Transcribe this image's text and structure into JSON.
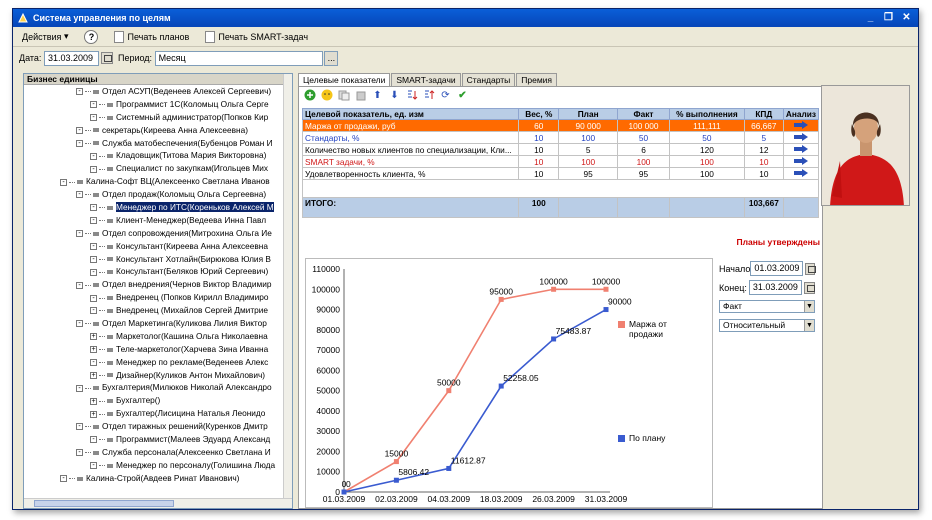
{
  "window": {
    "title": "Система управления по целям"
  },
  "menu": {
    "actions": "Действия",
    "help": "?",
    "print_plans": "Печать планов",
    "print_smart": "Печать SMART-задач"
  },
  "filter": {
    "date_label": "Дата:",
    "date_value": "31.03.2009",
    "period_label": "Период:",
    "period_value": "Месяц",
    "period_btn": "..."
  },
  "tree": {
    "header": "Бизнес единицы",
    "rows": [
      {
        "lvl": 2,
        "exp": "-",
        "text": "Отдел АСУП(Веденеев Алексей Сергеевич)"
      },
      {
        "lvl": 3,
        "exp": "-",
        "text": "Программист 1С(Коломыц Ольга Серге"
      },
      {
        "lvl": 3,
        "exp": "-",
        "text": "Системный администратор(Попков Кир"
      },
      {
        "lvl": 2,
        "exp": "-",
        "text": "секретарь(Киреева Анна Алексеевна)"
      },
      {
        "lvl": 2,
        "exp": "-",
        "text": "Служба матобеспечения(Бубенцов Роман И"
      },
      {
        "lvl": 3,
        "exp": "-",
        "text": "Кладовщик(Титова Мария Викторовна)"
      },
      {
        "lvl": 3,
        "exp": "-",
        "text": "Специалист по закупкам(Игольцев Мих"
      },
      {
        "lvl": 1,
        "exp": "-",
        "text": "Калина-Софт ВЦ(Алексеенко Светлана Иванов"
      },
      {
        "lvl": 2,
        "exp": "-",
        "text": "Отдел продаж(Коломыц Ольга Сергеевна)"
      },
      {
        "lvl": 3,
        "exp": "-",
        "text": "Менеджер по ИТС(Кореньков Алексей М",
        "sel": true
      },
      {
        "lvl": 3,
        "exp": "-",
        "text": "Клиент-Менеджер(Ведеева Инна Павл"
      },
      {
        "lvl": 2,
        "exp": "-",
        "text": "Отдел сопровождения(Митрохина Ольга Ие"
      },
      {
        "lvl": 3,
        "exp": "-",
        "text": "Консультант(Киреева Анна Алексеевна"
      },
      {
        "lvl": 3,
        "exp": "-",
        "text": "Консультант Хотлайн(Бирюкова Юлия В"
      },
      {
        "lvl": 3,
        "exp": "-",
        "text": "Консультант(Беляков Юрий Сергеевич)"
      },
      {
        "lvl": 2,
        "exp": "-",
        "text": "Отдел внедрения(Чернов Виктор Владимир"
      },
      {
        "lvl": 3,
        "exp": "-",
        "text": "Внедренец (Попков Кирилл Владимиро"
      },
      {
        "lvl": 3,
        "exp": "-",
        "text": "Внедренец (Михайлов Сергей Дмитрие"
      },
      {
        "lvl": 2,
        "exp": "-",
        "text": "Отдел Маркетинга(Куликова Лилия Виктор"
      },
      {
        "lvl": 3,
        "exp": "+",
        "text": "Маркетолог(Кашина Ольга Николаевна"
      },
      {
        "lvl": 3,
        "exp": "+",
        "text": "Теле-маркетолог(Харчева Зина Иванна"
      },
      {
        "lvl": 3,
        "exp": "-",
        "text": "Менеджер по рекламе(Веденеев Алекс"
      },
      {
        "lvl": 3,
        "exp": "+",
        "text": "Дизайнер(Куликов Антон Михайлович)"
      },
      {
        "lvl": 2,
        "exp": "-",
        "text": "Бухгалтерия(Милюков Николай Александро"
      },
      {
        "lvl": 3,
        "exp": "+",
        "text": "Бухгалтер()"
      },
      {
        "lvl": 3,
        "exp": "+",
        "text": "Бухгалтер(Лисицина Наталья Леонидо"
      },
      {
        "lvl": 2,
        "exp": "-",
        "text": "Отдел тиражных решений(Куренков Дмитр"
      },
      {
        "lvl": 3,
        "exp": "-",
        "text": "Программист(Малеев Эдуард Александ"
      },
      {
        "lvl": 2,
        "exp": "-",
        "text": "Служба персонала(Алексеенко Светлана И"
      },
      {
        "lvl": 3,
        "exp": "-",
        "text": "Менеджер по персоналу(Голишина Люда"
      },
      {
        "lvl": 1,
        "exp": "-",
        "text": "Калина-Строй(Авдеев Ринат Иванович)"
      }
    ]
  },
  "tabs": [
    "Целевые показатели",
    "SMART-задачи",
    "Стандарты",
    "Премия"
  ],
  "table": {
    "headers": [
      "Целевой показатель, ед. изм",
      "Вес, %",
      "План",
      "Факт",
      "% выполнения",
      "КПД",
      "Анализ"
    ],
    "rows": [
      {
        "name": "Маржа от продажи, руб",
        "weight": "60",
        "plan": "90 000",
        "fact": "100 000",
        "pct": "111,111",
        "kpd": "66,667",
        "style": "orange"
      },
      {
        "name": "Стандарты, %",
        "weight": "10",
        "plan": "100",
        "fact": "50",
        "pct": "50",
        "kpd": "5",
        "style": "blue"
      },
      {
        "name": "Количество новых клиентов по специализации, Кли...",
        "weight": "10",
        "plan": "5",
        "fact": "6",
        "pct": "120",
        "kpd": "12",
        "style": "normal"
      },
      {
        "name": "SMART задачи, %",
        "weight": "10",
        "plan": "100",
        "fact": "100",
        "pct": "100",
        "kpd": "10",
        "style": "red"
      },
      {
        "name": "Удовлетворенность клиента, %",
        "weight": "10",
        "plan": "95",
        "fact": "95",
        "pct": "100",
        "kpd": "10",
        "style": "normal"
      }
    ],
    "total": {
      "label": "ИТОГО:",
      "weight": "100",
      "kpd": "103,667"
    }
  },
  "status": "Планы утверждены",
  "side": {
    "start_label": "Начало",
    "start_value": "01.03.2009",
    "end_label": "Конец:",
    "end_value": "31.03.2009",
    "select1": "Факт",
    "select2": "Относительный"
  },
  "colors": {
    "fact": "#f08070",
    "plan": "#3a5bd0",
    "selection": "#0a246a",
    "header": "#b9cde6",
    "orange_row": "#ff6a00"
  },
  "chart_data": {
    "type": "line",
    "categories": [
      "01.03.2009",
      "02.03.2009",
      "04.03.2009",
      "18.03.2009",
      "26.03.2009",
      "31.03.2009"
    ],
    "ylim": [
      0,
      110000
    ],
    "yticks": [
      "0",
      "10000",
      "20000",
      "30000",
      "40000",
      "50000",
      "60000",
      "70000",
      "80000",
      "90000",
      "100000",
      "110000"
    ],
    "series": [
      {
        "name": "Маржа от продажи",
        "points": [
          [
            0,
            0
          ],
          [
            1,
            15000
          ],
          [
            2,
            50000
          ],
          [
            3,
            95000
          ],
          [
            4,
            100000
          ],
          [
            5,
            100000
          ]
        ],
        "labels": [
          "0",
          "15000",
          "50000",
          "95000",
          "100000",
          "100000"
        ]
      },
      {
        "name": "По плану",
        "points": [
          [
            0,
            0
          ],
          [
            1,
            5806.42
          ],
          [
            2,
            11612.87
          ],
          [
            3,
            52258.05
          ],
          [
            4,
            75483.87
          ],
          [
            5,
            90000
          ]
        ],
        "labels": [
          "0",
          "5806.42",
          "11612.87",
          "52258.05",
          "75483.87",
          "90000"
        ]
      }
    ]
  }
}
